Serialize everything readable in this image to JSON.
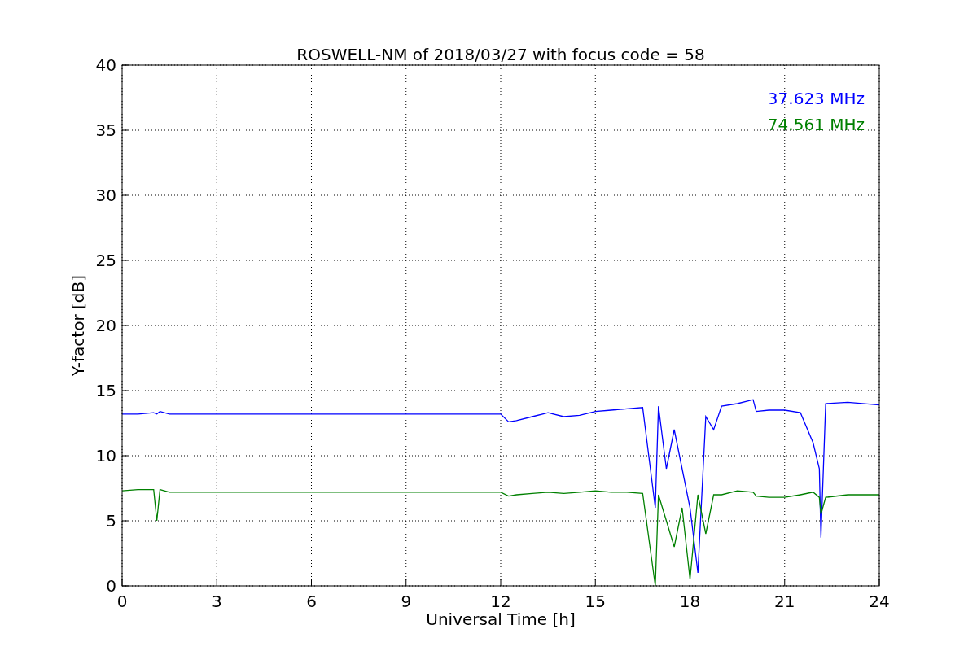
{
  "chart": {
    "chart_data": {
      "type": "line",
      "title": "ROSWELL-NM of 2018/03/27 with focus code = 58",
      "xlabel": "Universal Time [h]",
      "ylabel": "Y-factor [dB]",
      "x": [
        0,
        0.5,
        1,
        1.1,
        1.2,
        1.5,
        3,
        6,
        9,
        12,
        12.25,
        12.5,
        13,
        13.5,
        14,
        14.5,
        15,
        15.5,
        16,
        16.5,
        16.9,
        17,
        17.25,
        17.5,
        17.75,
        18,
        18.25,
        18.5,
        18.75,
        19,
        19.5,
        20,
        20.1,
        20.5,
        21,
        21.5,
        21.9,
        22.1,
        22.15,
        22.3,
        23,
        24
      ],
      "series": [
        {
          "name": "37.623 MHz",
          "color": "#0000ff",
          "values": [
            13.2,
            13.2,
            13.3,
            13.2,
            13.4,
            13.2,
            13.2,
            13.2,
            13.2,
            13.2,
            12.6,
            12.7,
            13.0,
            13.3,
            13.0,
            13.1,
            13.4,
            13.5,
            13.6,
            13.7,
            6,
            13.8,
            9,
            12,
            9,
            6,
            1,
            13,
            12,
            13.8,
            14.0,
            14.3,
            13.4,
            13.5,
            13.5,
            13.3,
            11,
            9,
            3.7,
            14,
            14.1,
            13.9
          ]
        },
        {
          "name": "74.561 MHz",
          "color": "#008000",
          "values": [
            7.3,
            7.4,
            7.4,
            5.0,
            7.4,
            7.2,
            7.2,
            7.2,
            7.2,
            7.2,
            6.9,
            7.0,
            7.1,
            7.2,
            7.1,
            7.2,
            7.3,
            7.2,
            7.2,
            7.1,
            0,
            7,
            5,
            3,
            6,
            0.5,
            7,
            4,
            7,
            7.0,
            7.3,
            7.2,
            6.9,
            6.8,
            6.8,
            7.0,
            7.2,
            6.8,
            5.5,
            6.8,
            7.0,
            7.0
          ]
        }
      ],
      "grid": true,
      "xlim": [
        0,
        24
      ],
      "ylim": [
        0,
        40
      ],
      "xticks": [
        0,
        3,
        6,
        9,
        12,
        15,
        18,
        21,
        24
      ],
      "yticks": [
        0,
        5,
        10,
        15,
        20,
        25,
        30,
        35,
        40
      ]
    }
  }
}
